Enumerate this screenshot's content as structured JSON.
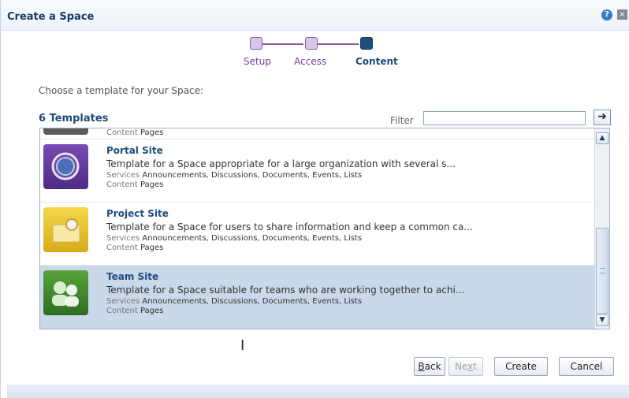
{
  "dialog": {
    "title": "Create a Space",
    "help_icon_glyph": "?",
    "close_icon_glyph": "×"
  },
  "train": {
    "steps": [
      {
        "label": "Setup",
        "state": "done"
      },
      {
        "label": "Access",
        "state": "done"
      },
      {
        "label": "Content",
        "state": "current"
      }
    ]
  },
  "prompt": "Choose a template for your Space:",
  "templates": {
    "count_label": "6 Templates",
    "filter_label": "Filter",
    "filter_value": "",
    "filter_go_glyph": "➜",
    "partial_row": {
      "content_label": "Content",
      "content_value": "Pages"
    },
    "items": [
      {
        "name": "Portal Site",
        "description": "Template for a Space appropriate for a large organization with several s...",
        "services_label": "Services",
        "services": "Announcements, Discussions, Documents, Events, Lists",
        "content_label": "Content",
        "content": "Pages",
        "icon": "portal-icon",
        "selected": false
      },
      {
        "name": "Project Site",
        "description": "Template for a Space for users to share information and keep a common ca...",
        "services_label": "Services",
        "services": "Announcements, Discussions, Documents, Events, Lists",
        "content_label": "Content",
        "content": "Pages",
        "icon": "project-folder-icon",
        "selected": false
      },
      {
        "name": "Team Site",
        "description": "Template for a Space suitable for teams who are working together to achi...",
        "services_label": "Services",
        "services": "Announcements, Discussions, Documents, Events, Lists",
        "content_label": "Content",
        "content": "Pages",
        "icon": "team-people-icon",
        "selected": true
      }
    ]
  },
  "scrollbar": {
    "up_glyph": "▲",
    "down_glyph": "▼"
  },
  "buttons": {
    "back_prefix": "B",
    "back_rest": "ack",
    "next_prefix": "Ne",
    "next_u": "x",
    "next_rest": "t",
    "create": "Create",
    "cancel": "Cancel"
  },
  "cursor_glyph": "I",
  "colors": {
    "accent": "#1f4d7b",
    "train": "#8a5aa7",
    "selected_row": "#c9d8ea"
  }
}
